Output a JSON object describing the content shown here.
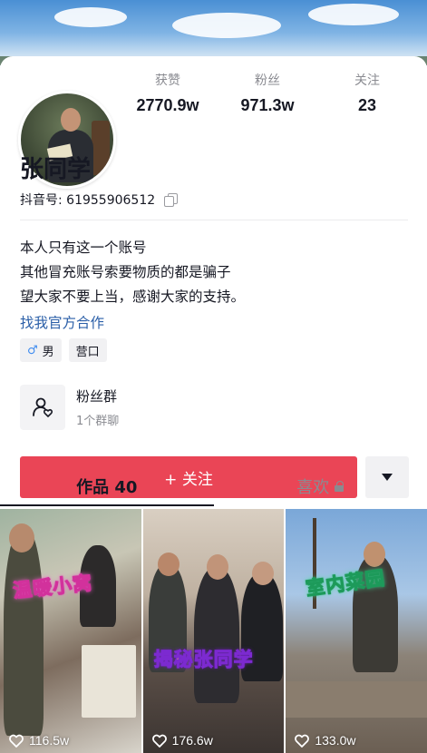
{
  "profile": {
    "name": "张同学",
    "douyin_id": "抖音号: 61955906512",
    "bio_lines": [
      "本人只有这一个账号",
      "其他冒充账号索要物质的都是骗子",
      "望大家不要上当，感谢大家的支持。"
    ],
    "cooperation_link": "找我官方合作",
    "tags": [
      {
        "label": "男",
        "icon": "male-icon"
      },
      {
        "label": "营口"
      }
    ]
  },
  "stats": [
    {
      "label": "获赞",
      "value": "2770.9w"
    },
    {
      "label": "粉丝",
      "value": "971.3w"
    },
    {
      "label": "关注",
      "value": "23"
    }
  ],
  "fan_group": {
    "title": "粉丝群",
    "subtitle": "1个群聊"
  },
  "actions": {
    "follow_label": "+ 关注"
  },
  "tabs": [
    {
      "label": "作品 40",
      "active": true
    },
    {
      "label": "喜欢",
      "locked": true
    }
  ],
  "videos": [
    {
      "caption": "温暖小窝",
      "likes": "116.5w"
    },
    {
      "caption": "揭秘张同学",
      "likes": "176.6w"
    },
    {
      "caption": "室内菜园",
      "likes": "133.0w"
    }
  ],
  "colors": {
    "follow_button": "#ea4556",
    "link": "#2b5fa8",
    "male": "#3f8cf0"
  }
}
